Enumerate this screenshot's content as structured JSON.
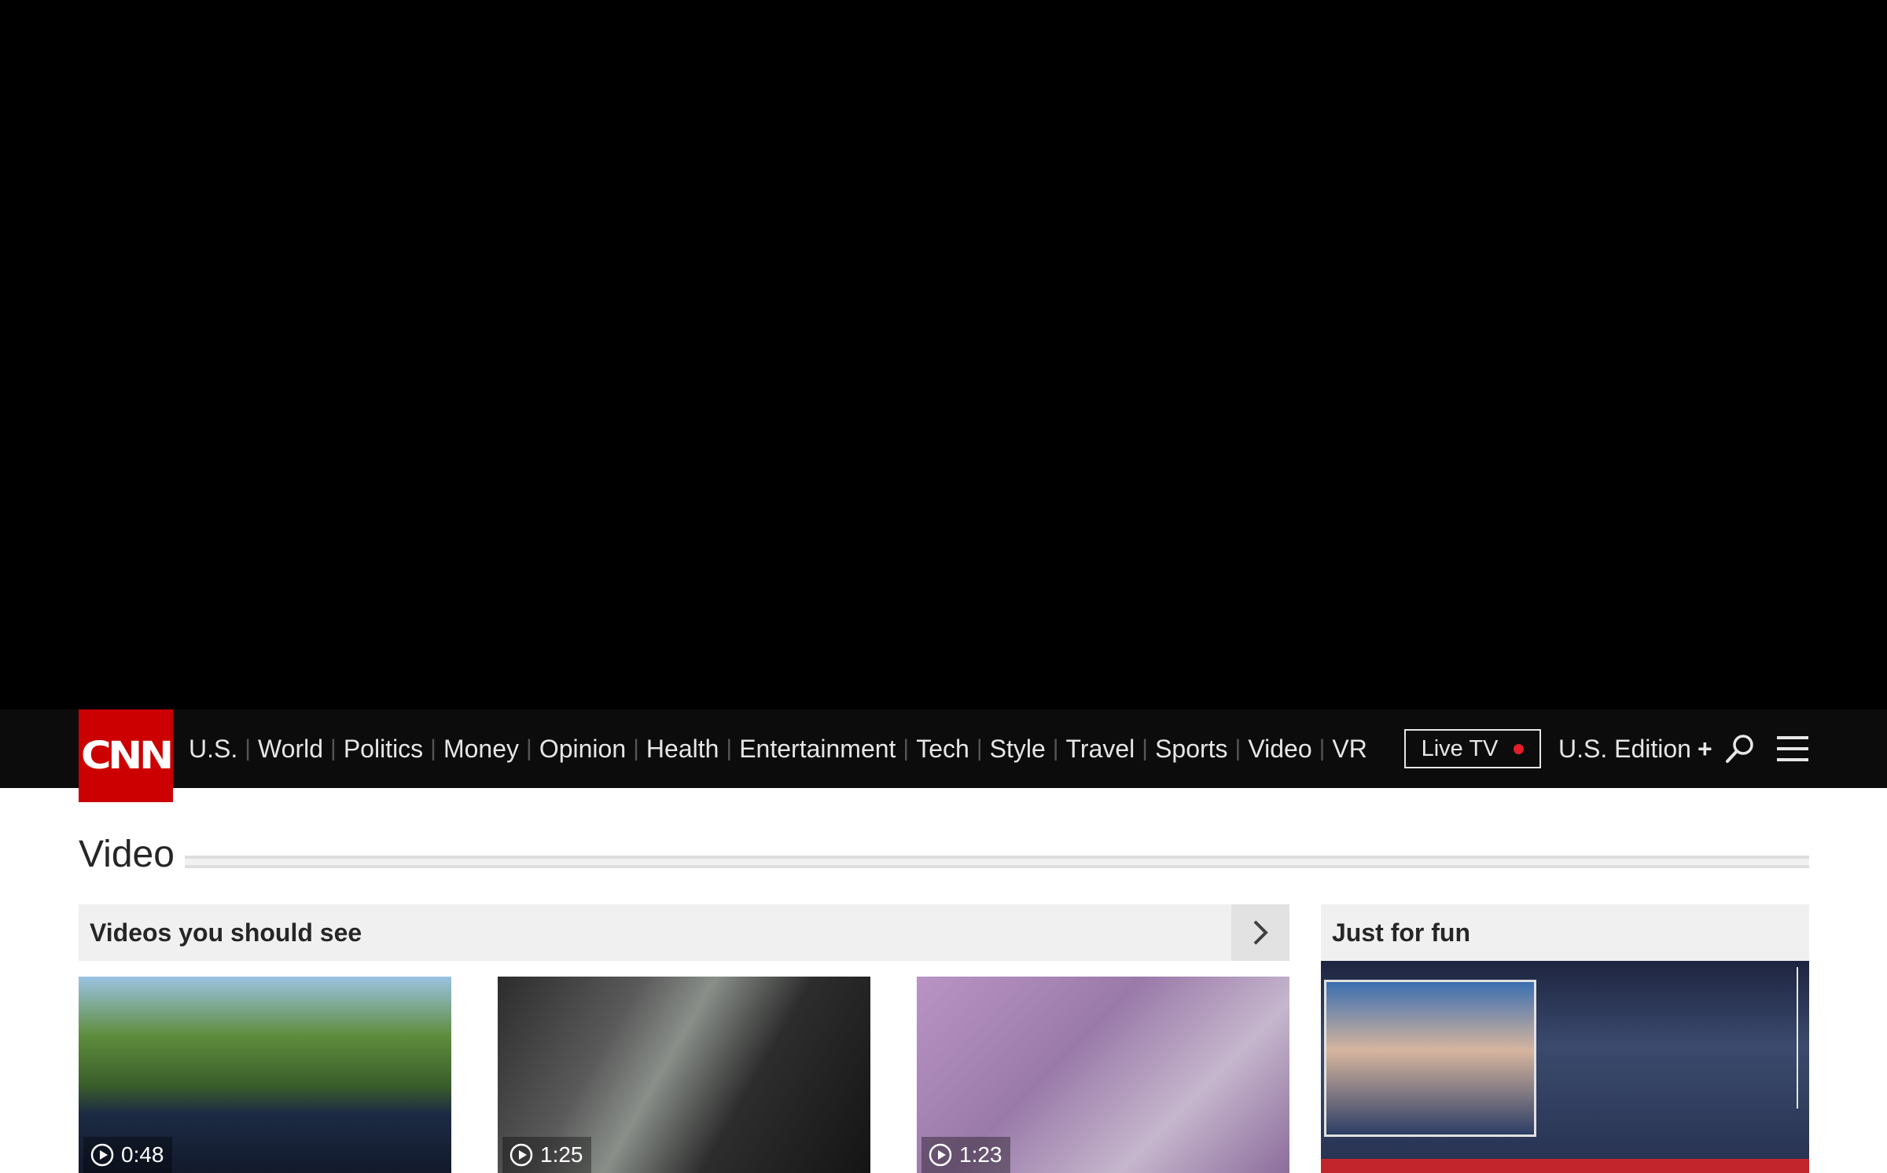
{
  "header": {
    "logo_text": "CNN",
    "nav_items": [
      "U.S.",
      "World",
      "Politics",
      "Money",
      "Opinion",
      "Health",
      "Entertainment",
      "Tech",
      "Style",
      "Travel",
      "Sports",
      "Video",
      "VR"
    ],
    "live_tv_label": "Live TV",
    "edition_label": "U.S. Edition",
    "edition_plus": "+"
  },
  "section": {
    "title": "Video"
  },
  "zones": {
    "main_title": "Videos you should see",
    "side_title": "Just for fun"
  },
  "cards": [
    {
      "duration": "0:48"
    },
    {
      "duration": "1:25"
    },
    {
      "duration": "1:23"
    }
  ],
  "colors": {
    "brand": "#cc0000",
    "nav_bg": "#0c0c0c",
    "live_dot": "#e41d27"
  },
  "icons": {
    "search": "search-icon",
    "menu": "hamburger-menu-icon",
    "arrow": "chevron-right-icon",
    "play": "play-icon"
  }
}
